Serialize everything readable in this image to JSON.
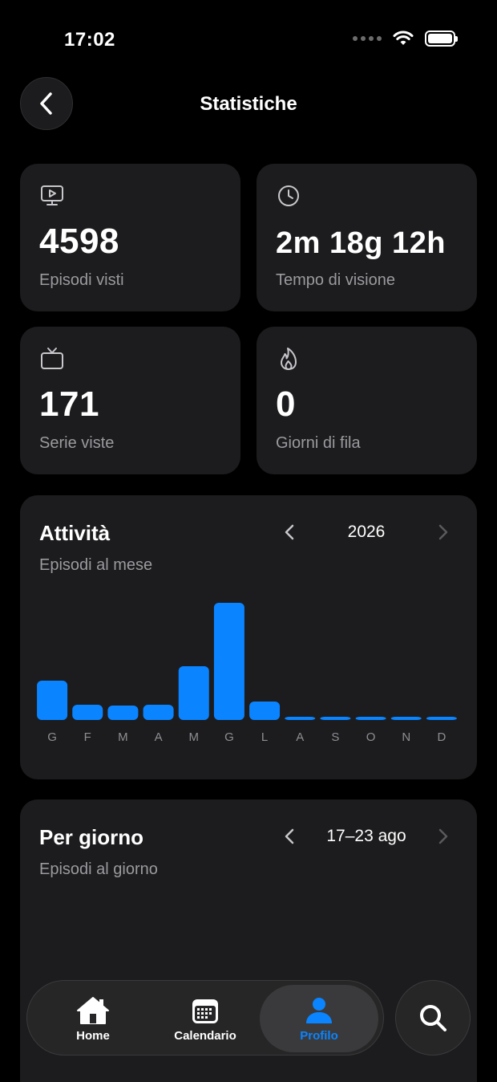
{
  "status_bar": {
    "time": "17:02"
  },
  "header": {
    "title": "Statistiche"
  },
  "stats": [
    {
      "icon": "monitor-play-icon",
      "value": "4598",
      "label": "Episodi visti"
    },
    {
      "icon": "clock-icon",
      "value": "2m 18g 12h",
      "label": "Tempo di visione"
    },
    {
      "icon": "tv-icon",
      "value": "171",
      "label": "Serie viste"
    },
    {
      "icon": "flame-icon",
      "value": "0",
      "label": "Giorni di fila"
    }
  ],
  "activity": {
    "title": "Attività",
    "subtitle": "Episodi al mese",
    "period": "2026"
  },
  "per_day": {
    "title": "Per giorno",
    "subtitle": "Episodi al giorno",
    "period": "17–23 ago"
  },
  "chart_data": {
    "type": "bar",
    "categories": [
      "G",
      "F",
      "M",
      "A",
      "M",
      "G",
      "L",
      "A",
      "S",
      "O",
      "N",
      "D"
    ],
    "values": [
      49,
      19,
      18,
      19,
      67,
      146,
      23,
      4,
      4,
      4,
      4,
      4
    ],
    "ylim": [
      0,
      160
    ],
    "grid": false,
    "color": "#0a84ff"
  },
  "tabs": [
    {
      "label": "Home",
      "icon": "home-icon"
    },
    {
      "label": "Calendario",
      "icon": "calendar-icon"
    },
    {
      "label": "Profilo",
      "icon": "person-icon"
    }
  ],
  "colors": {
    "accent": "#0a84ff",
    "card": "#1c1c1e",
    "muted": "#9a9a9f"
  }
}
